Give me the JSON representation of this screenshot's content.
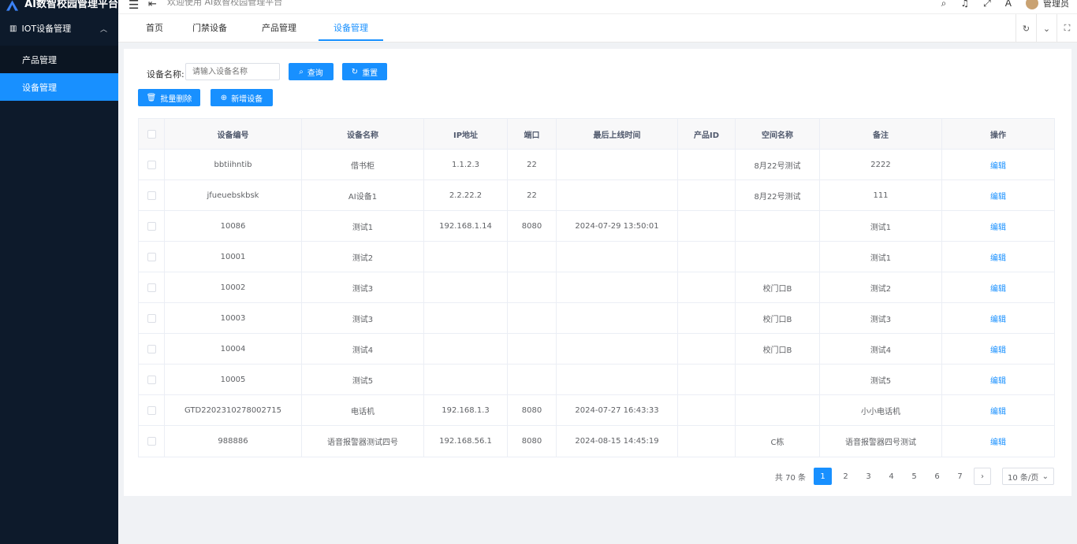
{
  "app": {
    "title": "AI数智校园管理平台",
    "brand_color": "#1890ff",
    "sidebar_bg": "#0d1a2b"
  },
  "sidebar": {
    "group_label": "IOT设备管理",
    "items": [
      {
        "label": "产品管理",
        "active": false
      },
      {
        "label": "设备管理",
        "active": true
      }
    ]
  },
  "topbar": {
    "welcome": "欢迎使用 AI数智校园管理平台",
    "user": "管理员"
  },
  "tabs": [
    {
      "label": "首页",
      "active": false
    },
    {
      "label": "门禁设备",
      "active": false
    },
    {
      "label": "产品管理",
      "active": false
    },
    {
      "label": "设备管理",
      "active": true
    }
  ],
  "search": {
    "label": "设备名称:",
    "placeholder": "请输入设备名称",
    "query_label": "查询",
    "reset_label": "重置"
  },
  "actions": {
    "batch_delete": "批量删除",
    "add_device": "新增设备"
  },
  "table": {
    "columns": [
      "设备编号",
      "设备名称",
      "IP地址",
      "端口",
      "最后上线时间",
      "产品ID",
      "空间名称",
      "备注",
      "操作"
    ],
    "rows": [
      {
        "code": "bbtiihntib",
        "name": "借书柜",
        "ip": "1.1.2.3",
        "port": "22",
        "last_online": "",
        "product_id": "",
        "space": "8月22号测试",
        "note": "2222",
        "op": "编辑"
      },
      {
        "code": "jfueuebskbsk",
        "name": "AI设备1",
        "ip": "2.2.22.2",
        "port": "22",
        "last_online": "",
        "product_id": "",
        "space": "8月22号测试",
        "note": "111",
        "op": "编辑"
      },
      {
        "code": "10086",
        "name": "测试1",
        "ip": "192.168.1.14",
        "port": "8080",
        "last_online": "2024-07-29 13:50:01",
        "product_id": "",
        "space": "",
        "note": "测试1",
        "op": "编辑"
      },
      {
        "code": "10001",
        "name": "测试2",
        "ip": "",
        "port": "",
        "last_online": "",
        "product_id": "",
        "space": "",
        "note": "测试1",
        "op": "编辑"
      },
      {
        "code": "10002",
        "name": "测试3",
        "ip": "",
        "port": "",
        "last_online": "",
        "product_id": "",
        "space": "校门口B",
        "note": "测试2",
        "op": "编辑"
      },
      {
        "code": "10003",
        "name": "测试3",
        "ip": "",
        "port": "",
        "last_online": "",
        "product_id": "",
        "space": "校门口B",
        "note": "测试3",
        "op": "编辑"
      },
      {
        "code": "10004",
        "name": "测试4",
        "ip": "",
        "port": "",
        "last_online": "",
        "product_id": "",
        "space": "校门口B",
        "note": "测试4",
        "op": "编辑"
      },
      {
        "code": "10005",
        "name": "测试5",
        "ip": "",
        "port": "",
        "last_online": "",
        "product_id": "",
        "space": "",
        "note": "测试5",
        "op": "编辑"
      },
      {
        "code": "GTD2202310278002715",
        "name": "电话机",
        "ip": "192.168.1.3",
        "port": "8080",
        "last_online": "2024-07-27 16:43:33",
        "product_id": "",
        "space": "",
        "note": "小小电话机",
        "op": "编辑"
      },
      {
        "code": "988886",
        "name": "语音报警器测试四号",
        "ip": "192.168.56.1",
        "port": "8080",
        "last_online": "2024-08-15 14:45:19",
        "product_id": "",
        "space": "C栋",
        "note": "语音报警器四号测试",
        "op": "编辑"
      }
    ]
  },
  "pagination": {
    "total_text": "共 70 条",
    "pages": [
      "1",
      "2",
      "3",
      "4",
      "5",
      "6",
      "7"
    ],
    "current": "1",
    "page_size": "10 条/页"
  }
}
